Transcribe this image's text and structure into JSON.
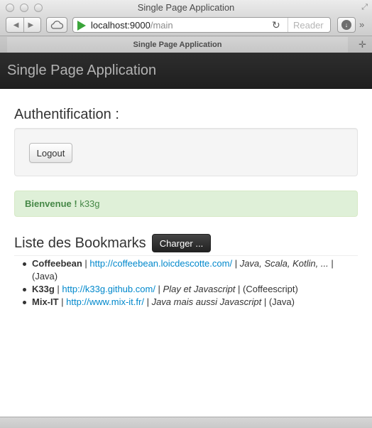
{
  "browser": {
    "window_title": "Single Page Application",
    "url_host": "localhost:9000",
    "url_path": "/main",
    "reader_label": "Reader",
    "tab_title": "Single Page Application"
  },
  "navbar": {
    "brand": "Single Page Application"
  },
  "auth": {
    "title": "Authentification :",
    "logout_label": "Logout"
  },
  "alert": {
    "strong": "Bienvenue !",
    "user": "k33g"
  },
  "bookmarks": {
    "title": "Liste des Bookmarks",
    "load_label": "Charger ...",
    "items": [
      {
        "name": "Coffeebean",
        "url": "http://coffeebean.loicdescotte.com/",
        "desc": "Java, Scala, Kotlin, ...",
        "tag": "(Java)"
      },
      {
        "name": "K33g",
        "url": "http://k33g.github.com/",
        "desc": "Play et Javascript",
        "tag": "(Coffeescript)"
      },
      {
        "name": "Mix-IT",
        "url": "http://www.mix-it.fr/",
        "desc": "Java mais aussi Javascript",
        "tag": "(Java)"
      }
    ]
  },
  "icons": {
    "back": "back-arrow-icon",
    "forward": "forward-arrow-icon",
    "cloud": "icloud-icon",
    "reload": "reload-icon",
    "download": "download-icon",
    "more": "chevron-double-right-icon",
    "new_tab": "new-tab-icon",
    "fullscreen": "fullscreen-icon"
  },
  "colors": {
    "navbar_bg": "#222222",
    "link": "#0088cc",
    "alert_bg": "#dff0d8",
    "alert_text": "#468847"
  }
}
